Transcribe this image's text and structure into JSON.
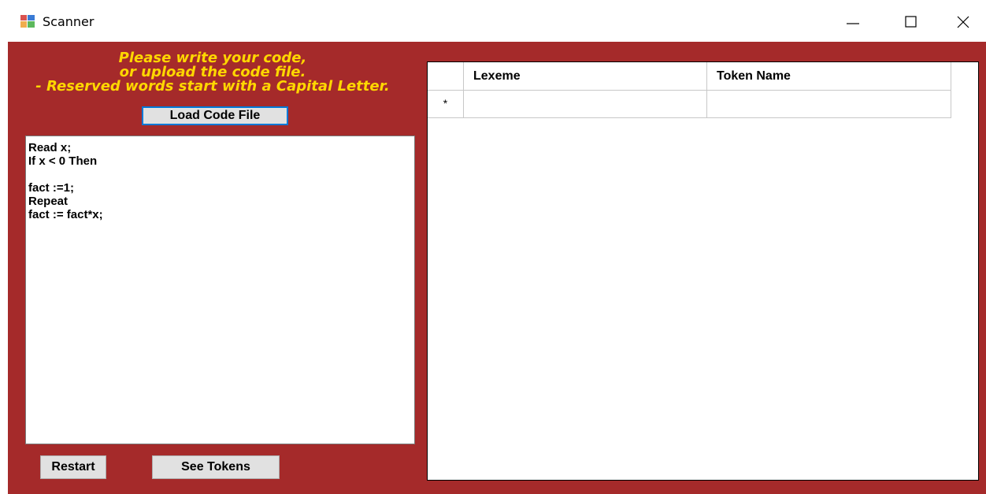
{
  "window": {
    "title": "Scanner",
    "minimize_glyph": "—",
    "maximize_glyph": "☐",
    "close_glyph": "✕"
  },
  "colors": {
    "background": "#a52a2a",
    "instruction_text": "#ffd700",
    "button_face": "#e1e1e1",
    "focus_border": "#0078d7"
  },
  "left_panel": {
    "instructions": [
      "Please write your code,",
      "or upload the code file.",
      "- Reserved words start with a Capital Letter."
    ],
    "load_button": "Load Code File",
    "code_text": "Read x;\nIf x < 0 Then\n\nfact :=1;\nRepeat\nfact := fact*x;",
    "restart_button": "Restart",
    "see_tokens_button": "See Tokens"
  },
  "token_grid": {
    "columns": [
      "Lexeme",
      "Token Name"
    ],
    "new_row_marker": "*",
    "rows": []
  }
}
